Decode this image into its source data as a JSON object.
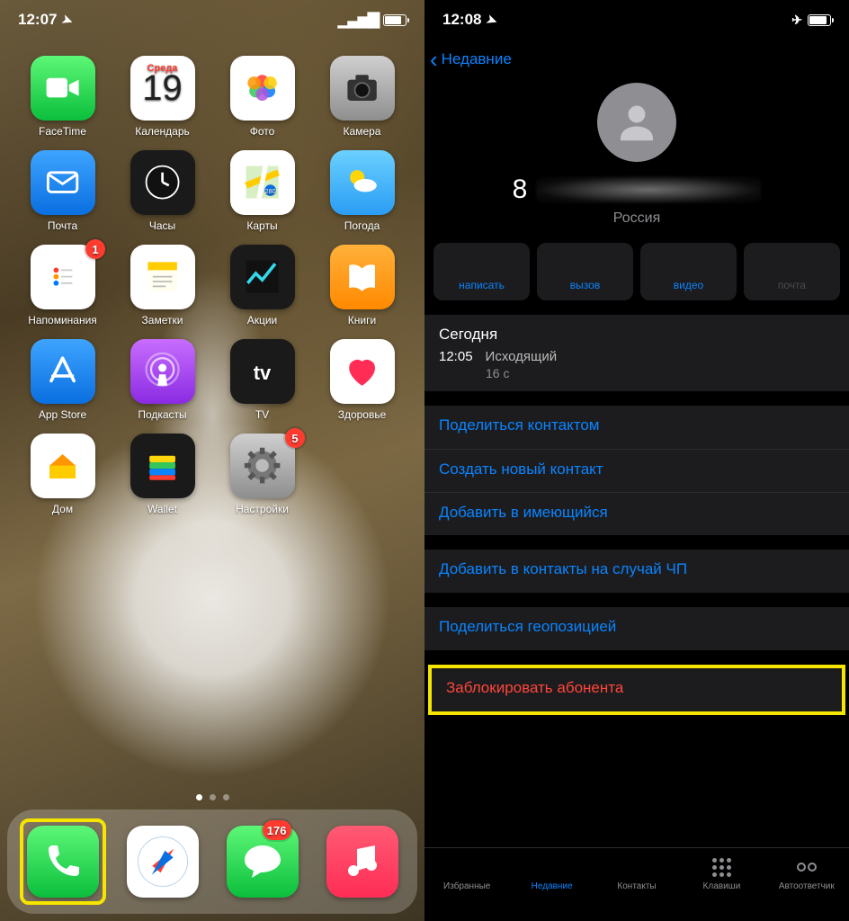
{
  "left": {
    "time": "12:07",
    "apps": [
      {
        "name": "facetime",
        "label": "FaceTime",
        "bg": "bg-green",
        "glyph": "video"
      },
      {
        "name": "calendar",
        "label": "Календарь",
        "bg": "bg-white",
        "glyph": "calendar",
        "cal_day": "Среда",
        "cal_num": "19"
      },
      {
        "name": "photos",
        "label": "Фото",
        "bg": "bg-white",
        "glyph": "photos"
      },
      {
        "name": "camera",
        "label": "Камера",
        "bg": "bg-gray",
        "glyph": "camera"
      },
      {
        "name": "mail",
        "label": "Почта",
        "bg": "bg-blue",
        "glyph": "mail"
      },
      {
        "name": "clock",
        "label": "Часы",
        "bg": "bg-dark",
        "glyph": "clock"
      },
      {
        "name": "maps",
        "label": "Карты",
        "bg": "bg-white",
        "glyph": "maps"
      },
      {
        "name": "weather",
        "label": "Погода",
        "bg": "bg-lightblue",
        "glyph": "weather"
      },
      {
        "name": "reminders",
        "label": "Напоминания",
        "bg": "bg-white",
        "glyph": "reminders",
        "badge": "1"
      },
      {
        "name": "notes",
        "label": "Заметки",
        "bg": "bg-white",
        "glyph": "notes"
      },
      {
        "name": "stocks",
        "label": "Акции",
        "bg": "bg-dark",
        "glyph": "stocks"
      },
      {
        "name": "books",
        "label": "Книги",
        "bg": "bg-orange",
        "glyph": "books"
      },
      {
        "name": "appstore",
        "label": "App Store",
        "bg": "bg-blue",
        "glyph": "appstore"
      },
      {
        "name": "podcasts",
        "label": "Подкасты",
        "bg": "bg-purple",
        "glyph": "podcasts"
      },
      {
        "name": "tv",
        "label": "TV",
        "bg": "bg-dark",
        "glyph": "tv"
      },
      {
        "name": "health",
        "label": "Здоровье",
        "bg": "bg-white",
        "glyph": "health"
      },
      {
        "name": "home",
        "label": "Дом",
        "bg": "bg-white",
        "glyph": "home"
      },
      {
        "name": "wallet",
        "label": "Wallet",
        "bg": "bg-dark",
        "glyph": "wallet"
      },
      {
        "name": "settings",
        "label": "Настройки",
        "bg": "bg-gray",
        "glyph": "settings",
        "badge": "5"
      }
    ],
    "dock": [
      {
        "name": "phone",
        "bg": "bg-green",
        "glyph": "phone",
        "highlight": true
      },
      {
        "name": "safari",
        "bg": "bg-white",
        "glyph": "safari"
      },
      {
        "name": "messages",
        "bg": "bg-messages",
        "glyph": "messages",
        "badge": "176"
      },
      {
        "name": "music",
        "bg": "bg-music",
        "glyph": "music"
      }
    ]
  },
  "right": {
    "time": "12:08",
    "back_label": "Недавние",
    "phone_prefix": "8",
    "country": "Россия",
    "actions": [
      {
        "name": "message",
        "label": "написать",
        "glyph": "message"
      },
      {
        "name": "call",
        "label": "вызов",
        "glyph": "call"
      },
      {
        "name": "video",
        "label": "видео",
        "glyph": "video"
      },
      {
        "name": "mail",
        "label": "почта",
        "glyph": "mail",
        "disabled": true
      }
    ],
    "history": {
      "day": "Сегодня",
      "time": "12:05",
      "type": "Исходящий",
      "duration": "16 с"
    },
    "rows1": [
      {
        "name": "share-contact",
        "label": "Поделиться контактом"
      },
      {
        "name": "create-contact",
        "label": "Создать новый контакт"
      },
      {
        "name": "add-existing",
        "label": "Добавить в имеющийся"
      }
    ],
    "rows2": [
      {
        "name": "emergency-contact",
        "label": "Добавить в контакты на случай ЧП"
      }
    ],
    "rows3": [
      {
        "name": "share-location",
        "label": "Поделиться геопозицией"
      }
    ],
    "block_label": "Заблокировать абонента",
    "tabs": [
      {
        "name": "favorites",
        "label": "Избранные",
        "glyph": "star"
      },
      {
        "name": "recents",
        "label": "Недавние",
        "glyph": "clock",
        "active": true
      },
      {
        "name": "contacts",
        "label": "Контакты",
        "glyph": "contact"
      },
      {
        "name": "keypad",
        "label": "Клавиши",
        "glyph": "keypad"
      },
      {
        "name": "voicemail",
        "label": "Автоответчик",
        "glyph": "voicemail"
      }
    ]
  }
}
